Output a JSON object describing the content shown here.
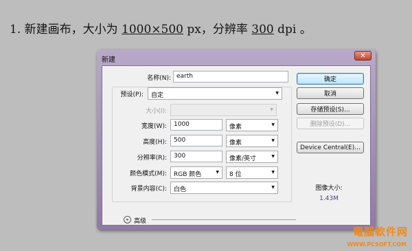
{
  "note": {
    "prefix": "1. 新建画布，大小为 ",
    "size": "1000×500",
    "mid": " px，分辨率 ",
    "res": "300",
    "suffix": " dpi 。"
  },
  "dialog": {
    "title": "新建",
    "close_icon": "close-icon",
    "name_label": "名称(N):",
    "name_value": "earth",
    "preset_label": "预设(P):",
    "preset_value": "自定",
    "size_label": "大小(I):",
    "size_value": "",
    "width_label": "宽度(W):",
    "width_value": "1000",
    "width_unit": "像素",
    "height_label": "高度(H):",
    "height_value": "500",
    "height_unit": "像素",
    "res_label": "分辨率(R):",
    "res_value": "300",
    "res_unit": "像素/英寸",
    "mode_label": "颜色模式(M):",
    "mode_value": "RGB 颜色",
    "bits_value": "8 位",
    "bg_label": "背景内容(C):",
    "bg_value": "白色",
    "advanced_label": "高级",
    "advanced_icon": "chevron-double-down-icon",
    "buttons": {
      "ok": "确定",
      "cancel": "取消",
      "save_preset": "存储预设(S)...",
      "delete_preset": "删除预设(D)...",
      "device_central": "Device Central(E)..."
    },
    "image_size_label": "图像大小:",
    "image_size_value": "1.43M"
  },
  "watermark": {
    "line1": "電腦軟件网",
    "line2": "WWW.PCSOFT.COM"
  }
}
